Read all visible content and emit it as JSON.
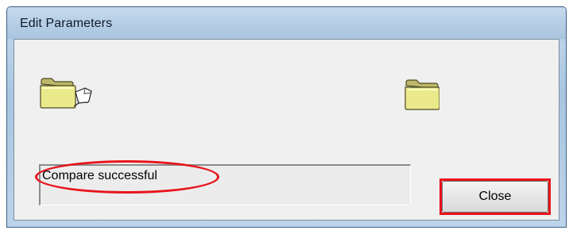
{
  "window": {
    "title": "Edit Parameters"
  },
  "icons": {
    "source": "folder-with-document-icon",
    "target": "folder-icon"
  },
  "status": {
    "text": "Compare successful"
  },
  "buttons": {
    "close_label": "Close"
  },
  "annotations": {
    "color": "#e8141c",
    "shapes": [
      "oval around status text",
      "rectangle around Close button"
    ]
  }
}
